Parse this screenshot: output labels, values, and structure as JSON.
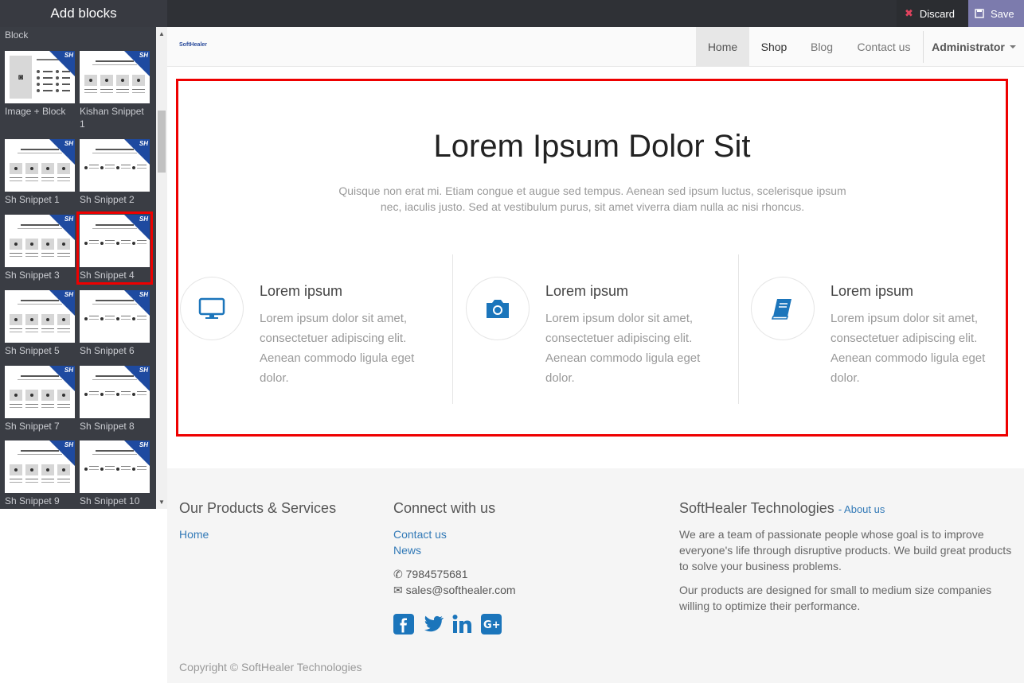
{
  "editor": {
    "title": "Add blocks",
    "discard_label": "Discard",
    "save_label": "Save"
  },
  "sidebar": {
    "category": "Block",
    "badge": "SH",
    "snippets": [
      {
        "label": "Image + Block"
      },
      {
        "label": "Kishan Snippet 1"
      },
      {
        "label": "Sh Snippet 1"
      },
      {
        "label": "Sh Snippet 2"
      },
      {
        "label": "Sh Snippet 3"
      },
      {
        "label": "Sh Snippet 4"
      },
      {
        "label": "Sh Snippet 5"
      },
      {
        "label": "Sh Snippet 6"
      },
      {
        "label": "Sh Snippet 7"
      },
      {
        "label": "Sh Snippet 8"
      },
      {
        "label": "Sh Snippet 9"
      },
      {
        "label": "Sh Snippet 10"
      }
    ],
    "selected": "Sh Snippet 4"
  },
  "navbar": {
    "logo": "SoftHealer",
    "items": [
      "Home",
      "Shop",
      "Blog",
      "Contact us"
    ],
    "user": "Administrator"
  },
  "hero": {
    "title": "Lorem Ipsum Dolor Sit",
    "subtitle": "Quisque non erat mi. Etiam congue et augue sed tempus. Aenean sed ipsum luctus, scelerisque ipsum nec, iaculis justo. Sed at vestibulum purus, sit amet viverra diam nulla ac nisi rhoncus.",
    "features": [
      {
        "icon": "monitor-icon",
        "title": "Lorem ipsum",
        "text": "Lorem ipsum dolor sit amet, consectetuer adipiscing elit. Aenean commodo ligula eget dolor."
      },
      {
        "icon": "camera-icon",
        "title": "Lorem ipsum",
        "text": "Lorem ipsum dolor sit amet, consectetuer adipiscing elit. Aenean commodo ligula eget dolor."
      },
      {
        "icon": "book-icon",
        "title": "Lorem ipsum",
        "text": "Lorem ipsum dolor sit amet, consectetuer adipiscing elit. Aenean commodo ligula eget dolor."
      }
    ]
  },
  "footer": {
    "col1": {
      "title": "Our Products & Services",
      "links": [
        "Home"
      ]
    },
    "col2": {
      "title": "Connect with us",
      "links": [
        "Contact us",
        "News"
      ],
      "phone": "7984575681",
      "email": "sales@softhealer.com"
    },
    "col3": {
      "title": "SoftHealer Technologies",
      "about_link": "About us",
      "p1": "We are a team of passionate people whose goal is to improve everyone's life through disruptive products. We build great products to solve your business problems.",
      "p2": "Our products are designed for small to medium size companies willing to optimize their performance."
    },
    "copyright": "Copyright © SoftHealer Technologies"
  },
  "colors": {
    "accent": "#337ab7",
    "highlight": "#e00000",
    "icon": "#1b75bb"
  }
}
